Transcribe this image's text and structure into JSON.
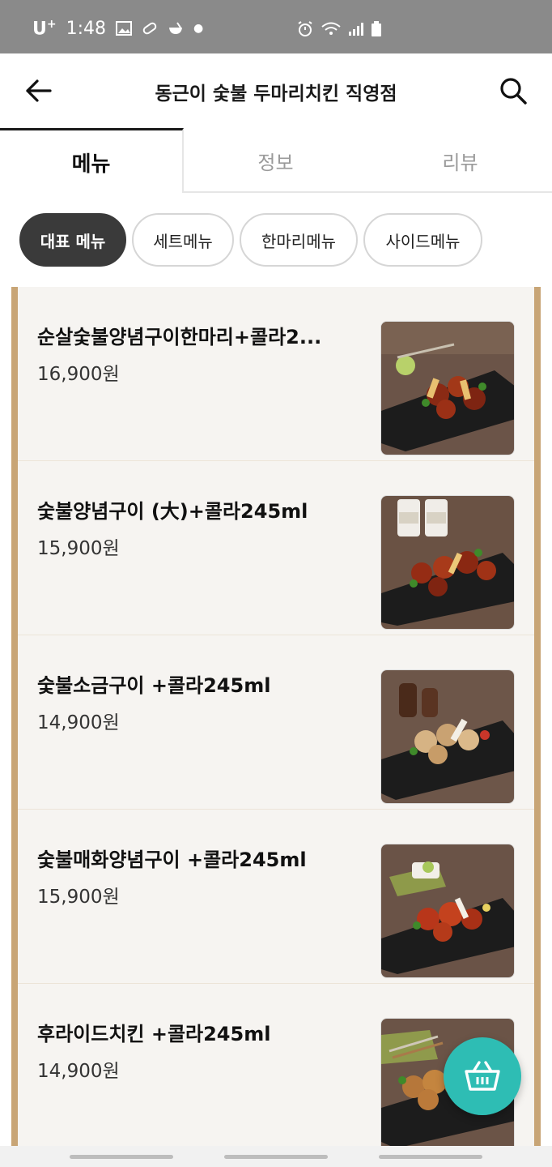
{
  "status_bar": {
    "carrier": "U",
    "carrier_sup": "+",
    "time": "1:48",
    "icons": [
      "gallery-icon",
      "pill-icon",
      "bowl-icon",
      "dot-icon",
      "alarm-icon",
      "wifi-icon",
      "signal-icon",
      "battery-icon"
    ]
  },
  "header": {
    "title": "동근이 숯불 두마리치킨 직영점",
    "back_icon": "back-arrow-icon",
    "search_icon": "search-icon"
  },
  "tabs": [
    {
      "label": "메뉴",
      "active": true
    },
    {
      "label": "정보",
      "active": false
    },
    {
      "label": "리뷰",
      "active": false
    }
  ],
  "chips": [
    {
      "label": "대표 메뉴",
      "selected": true
    },
    {
      "label": "세트메뉴",
      "selected": false
    },
    {
      "label": "한마리메뉴",
      "selected": false
    },
    {
      "label": "사이드메뉴",
      "selected": false
    }
  ],
  "menu_items": [
    {
      "name": "순살숯불양념구이한마리+콜라2...",
      "price": "16,900원",
      "photo": "spicy-chicken-boneless-photo"
    },
    {
      "name": "숯불양념구이 (大)+콜라245ml",
      "price": "15,900원",
      "photo": "spicy-chicken-large-photo"
    },
    {
      "name": "숯불소금구이 +콜라245ml",
      "price": "14,900원",
      "photo": "salt-grilled-chicken-photo"
    },
    {
      "name": "숯불매화양념구이 +콜라245ml",
      "price": "15,900원",
      "photo": "maehwa-spicy-chicken-photo"
    },
    {
      "name": "후라이드치킨 +콜라245ml",
      "price": "14,900원",
      "photo": "fried-chicken-photo"
    }
  ],
  "cart": {
    "icon": "basket-icon"
  },
  "colors": {
    "accent": "#2ebdb4",
    "frame": "#c8a576",
    "selected_chip": "#3a3a3a",
    "status_bar": "#8a8a8a"
  }
}
